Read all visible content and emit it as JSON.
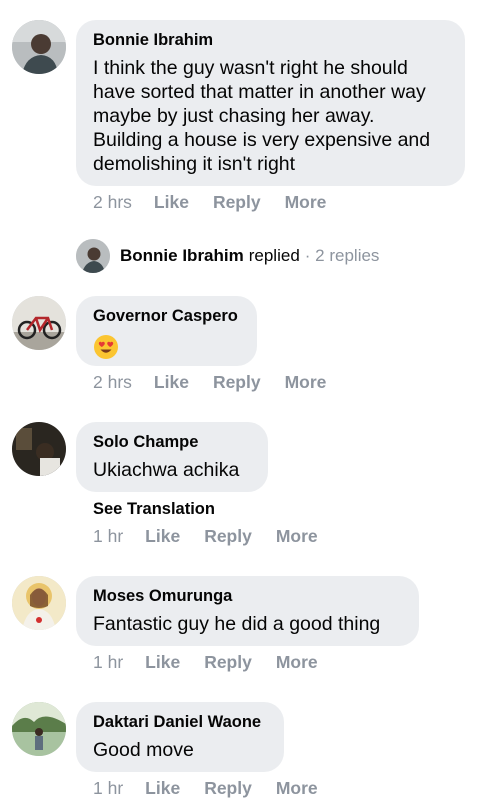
{
  "comments": [
    {
      "name": "Bonnie Ibrahim",
      "text": "I think the guy wasn't right he should have sorted that matter in another way maybe by just chasing her away. Building a house is very expensive and demolishing it isn't right",
      "time": "2 hrs",
      "like": "Like",
      "reply": "Reply",
      "more": "More"
    },
    {
      "name": "Governor Caspero",
      "emoji": "heart-eyes-emoji",
      "time": "2 hrs",
      "like": "Like",
      "reply": "Reply",
      "more": "More"
    },
    {
      "name": "Solo Champe",
      "text": "Ukiachwa achika",
      "see_translation": "See Translation",
      "time": "1 hr",
      "like": "Like",
      "reply": "Reply",
      "more": "More"
    },
    {
      "name": "Moses Omurunga",
      "text": "Fantastic guy he did a good thing",
      "time": "1 hr",
      "like": "Like",
      "reply": "Reply",
      "more": "More"
    },
    {
      "name": "Daktari Daniel Waone",
      "text": "Good move",
      "time": "1 hr",
      "like": "Like",
      "reply": "Reply",
      "more": "More"
    }
  ],
  "replies_summary": {
    "name": "Bonnie Ibrahim",
    "verb": "replied",
    "count": "· 2 replies"
  },
  "colors": {
    "bubble": "#ebedf0",
    "meta": "#8d949e",
    "text": "#050505"
  }
}
